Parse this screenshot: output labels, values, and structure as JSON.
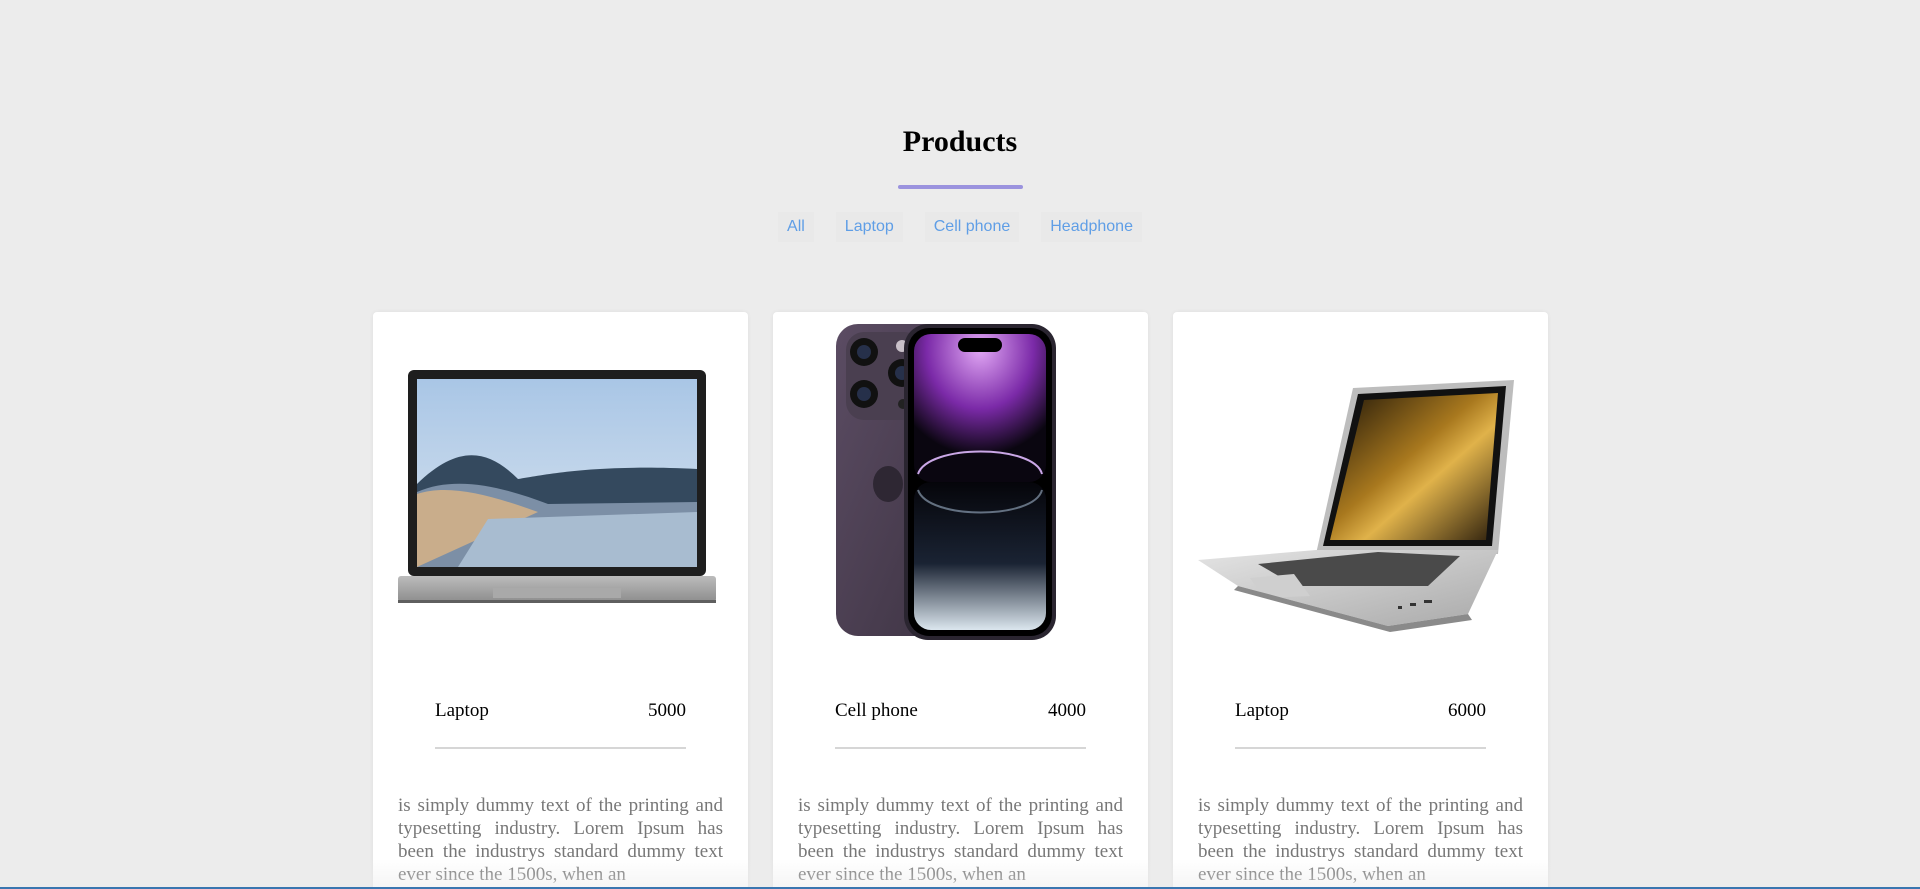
{
  "header": {
    "title": "Products"
  },
  "filters": [
    {
      "label": "All"
    },
    {
      "label": "Laptop"
    },
    {
      "label": "Cell phone"
    },
    {
      "label": "Headphone"
    }
  ],
  "colors": {
    "accent_underline": "#9b93de",
    "filter_text": "#5f9ee6"
  },
  "products": [
    {
      "image_icon": "laptop-surface-image",
      "name": "Laptop",
      "price": "5000",
      "description": "is simply dummy text of the printing and typesetting industry. Lorem Ipsum has been the industrys standard dummy text ever since the 1500s, when an"
    },
    {
      "image_icon": "iphone-image",
      "name": "Cell phone",
      "price": "4000",
      "description": "is simply dummy text of the printing and typesetting industry. Lorem Ipsum has been the industrys standard dummy text ever since the 1500s, when an"
    },
    {
      "image_icon": "laptop-hp-image",
      "name": "Laptop",
      "price": "6000",
      "description": "is simply dummy text of the printing and typesetting industry. Lorem Ipsum has been the industrys standard dummy text ever since the 1500s, when an"
    }
  ]
}
